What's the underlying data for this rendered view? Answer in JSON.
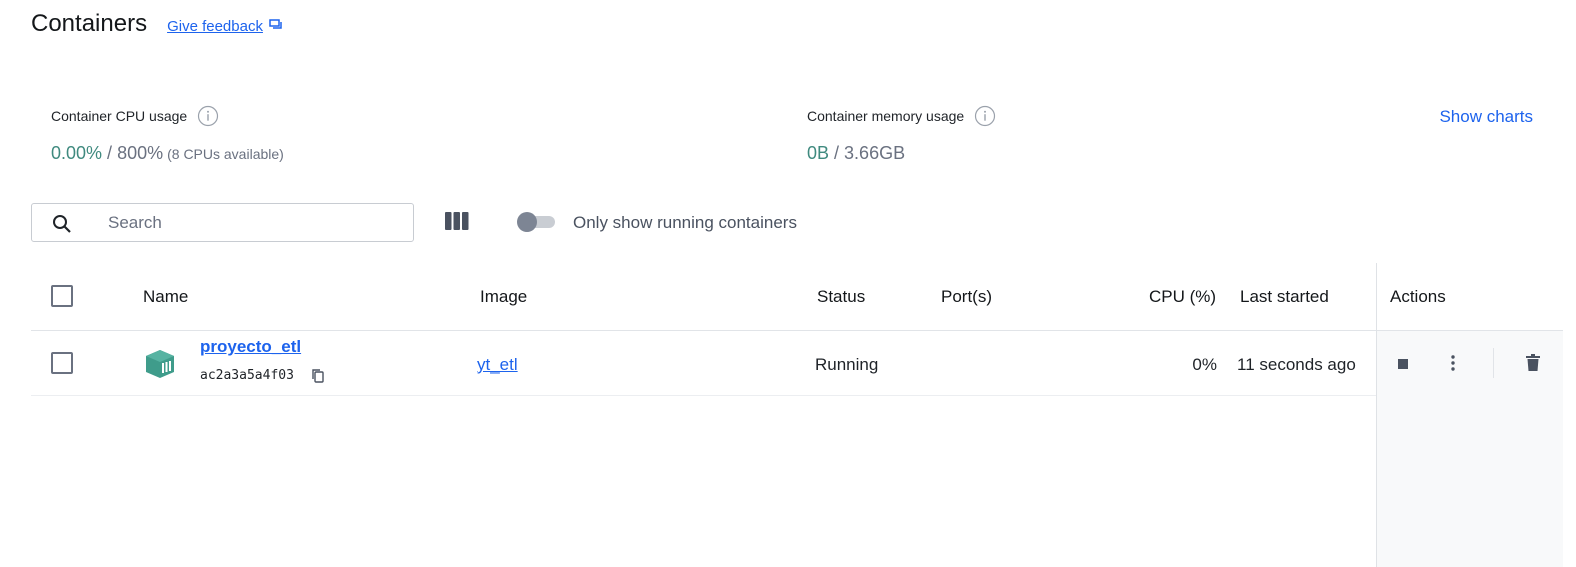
{
  "page": {
    "title": "Containers",
    "feedback_label": "Give feedback"
  },
  "stats": {
    "cpu": {
      "label": "Container CPU usage",
      "used": "0.00%",
      "separator": " / ",
      "total": "800%",
      "note": "(8 CPUs available)"
    },
    "memory": {
      "label": "Container memory usage",
      "used": "0B",
      "separator": " / ",
      "total": "3.66GB"
    },
    "show_charts_label": "Show charts"
  },
  "toolbar": {
    "search_placeholder": "Search",
    "search_value": "",
    "running_only_label": "Only show running containers",
    "running_only_enabled": false
  },
  "table": {
    "columns": {
      "name": "Name",
      "image": "Image",
      "status": "Status",
      "ports": "Port(s)",
      "cpu": "CPU (%)",
      "last_started": "Last started",
      "actions": "Actions"
    },
    "rows": [
      {
        "name": "proyecto_etl",
        "id": "ac2a3a5a4f03",
        "image": "yt_etl",
        "status": "Running",
        "ports": "",
        "cpu": "0%",
        "last_started": "11 seconds ago"
      }
    ]
  },
  "icons": {
    "search": "search-icon",
    "columns": "columns-icon",
    "info": "info-icon",
    "feedback": "chat-bubble-icon",
    "container": "container-icon",
    "copy": "copy-icon",
    "stop": "stop-icon",
    "more": "more-vertical-icon",
    "delete": "trash-icon"
  },
  "colors": {
    "accent": "#1d63ed",
    "usage_green": "#3f8a7f",
    "container_teal": "#3f9c8b",
    "muted": "#6a7180"
  }
}
